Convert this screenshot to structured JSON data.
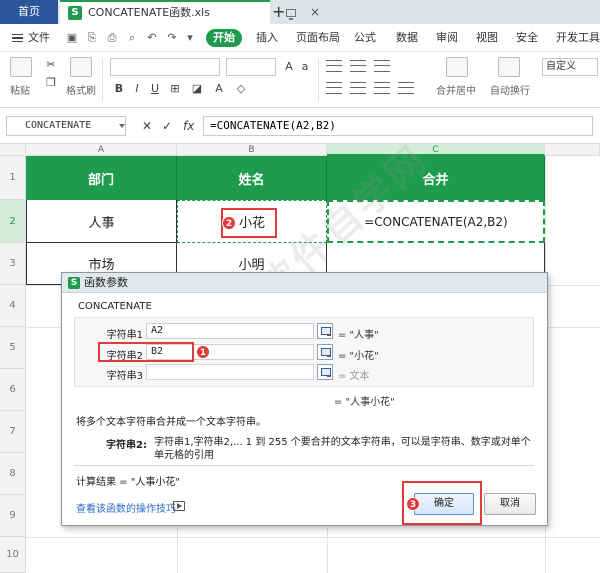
{
  "titlebar": {
    "home_tab": "首页",
    "doc_title": "CONCATENATE函数.xls",
    "app_logo": "S",
    "new_tab_symbol": "+",
    "close_symbol": "×"
  },
  "menubar": {
    "file_label": "文件",
    "start_label": "开始",
    "items": [
      "插入",
      "页面布局",
      "公式",
      "数据",
      "审阅",
      "视图",
      "安全",
      "开发工具"
    ]
  },
  "ribbon": {
    "paste_label": "粘贴",
    "format_painter_label": "格式刷",
    "merge_center_label": "合并居中",
    "wrap_text_label": "自动换行",
    "number_format_value": "自定义"
  },
  "formula_bar": {
    "name_box": "CONCATENATE",
    "cancel_symbol": "✕",
    "confirm_symbol": "✓",
    "fx_symbol": "fx",
    "formula": "=CONCATENATE(A2,B2)"
  },
  "grid": {
    "columns": [
      "A",
      "B",
      "C"
    ],
    "rows": [
      "1",
      "2",
      "3",
      "4",
      "5",
      "6",
      "7",
      "8",
      "9",
      "10"
    ],
    "header_row": [
      "部门",
      "姓名",
      "合并"
    ],
    "row2": [
      "人事",
      "小花",
      "=CONCATENATE(A2,B2)"
    ],
    "row3": [
      "市场",
      "小明",
      ""
    ]
  },
  "annotations": {
    "badge1": "1",
    "badge2": "2",
    "badge3": "3"
  },
  "dialog": {
    "logo": "S",
    "title": "函数参数",
    "function_name": "CONCATENATE",
    "args": [
      {
        "label": "字符串1",
        "value": "A2",
        "result": "= \"人事\""
      },
      {
        "label": "字符串2",
        "value": "B2",
        "result": "= \"小花\""
      },
      {
        "label": "字符串3",
        "value": "",
        "result": "= 文本"
      }
    ],
    "summary_result": "= \"人事小花\"",
    "description": "将多个文本字符串合并成一个文本字符串。",
    "param_label": "字符串2:",
    "param_desc": "字符串1,字符串2,... 1 到 255 个要合并的文本字符串，可以是字符串、数字或对单个单元格的引用",
    "calc_result": "计算结果 = \"人事小花\"",
    "help_link": "查看该函数的操作技巧",
    "ok_label": "确定",
    "cancel_label": "取消"
  },
  "watermark": "软件自学网",
  "colors": {
    "accent_green": "#1e9b4d",
    "header_fill": "#1e9b4d",
    "annotation_red": "#e23b3b",
    "link_blue": "#2c68c9"
  }
}
